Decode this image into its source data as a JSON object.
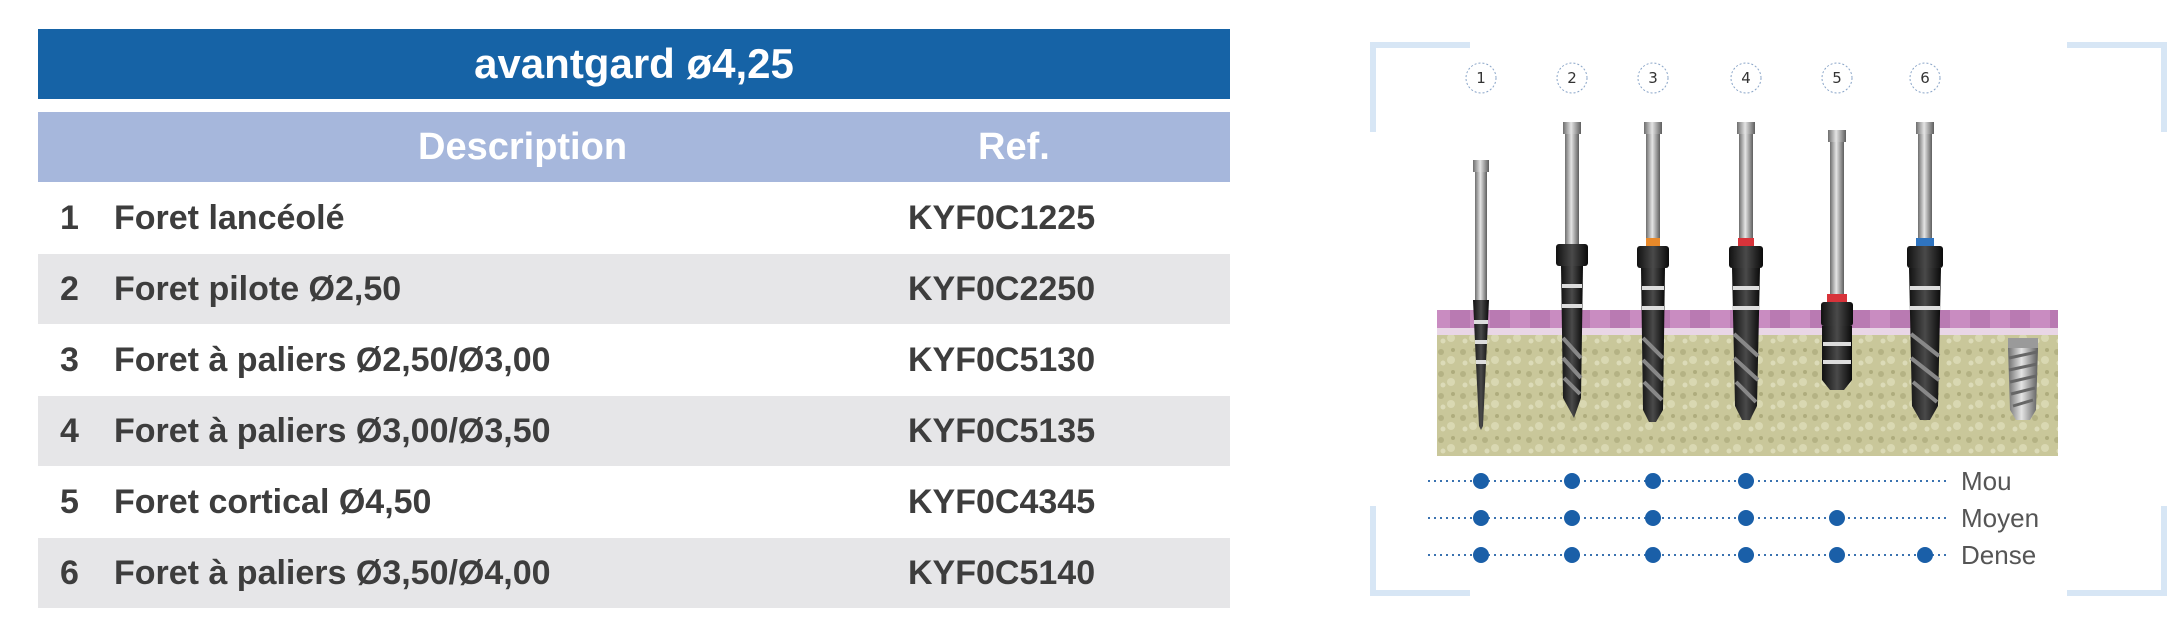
{
  "table": {
    "title": "avantgard ø4,25",
    "header": {
      "description": "Description",
      "ref": "Ref."
    },
    "rows": [
      {
        "num": "1",
        "description": "Foret lancéolé",
        "ref": "KYF0C1225"
      },
      {
        "num": "2",
        "description": "Foret pilote Ø2,50",
        "ref": "KYF0C2250"
      },
      {
        "num": "3",
        "description": "Foret à paliers Ø2,50/Ø3,00",
        "ref": "KYF0C5130"
      },
      {
        "num": "4",
        "description": "Foret à paliers Ø3,00/Ø3,50",
        "ref": "KYF0C5135"
      },
      {
        "num": "5",
        "description": "Foret cortical Ø4,50",
        "ref": "KYF0C4345"
      },
      {
        "num": "6",
        "description": "Foret à paliers Ø3,50/Ø4,00",
        "ref": "KYF0C5140"
      }
    ]
  },
  "figure": {
    "drill_numbers": [
      "1",
      "2",
      "3",
      "4",
      "5",
      "6"
    ],
    "bone_density": [
      {
        "label": "Mou",
        "drills": [
          1,
          2,
          3,
          4
        ]
      },
      {
        "label": "Moyen",
        "drills": [
          1,
          2,
          3,
          4,
          5
        ]
      },
      {
        "label": "Dense",
        "drills": [
          1,
          2,
          3,
          4,
          5,
          6
        ]
      }
    ],
    "colors": {
      "title_bar": "#1663a6",
      "header_bar": "#a6b7dc",
      "row_shade": "#e6e6e8",
      "dot": "#1a5fa8",
      "ring_drill3": "#e8892a",
      "ring_drill4": "#d8333a",
      "ring_drill5": "#d8333a",
      "ring_drill6": "#2f74c0",
      "gum": "#c98cc1",
      "bone": "#c9c79a"
    }
  }
}
